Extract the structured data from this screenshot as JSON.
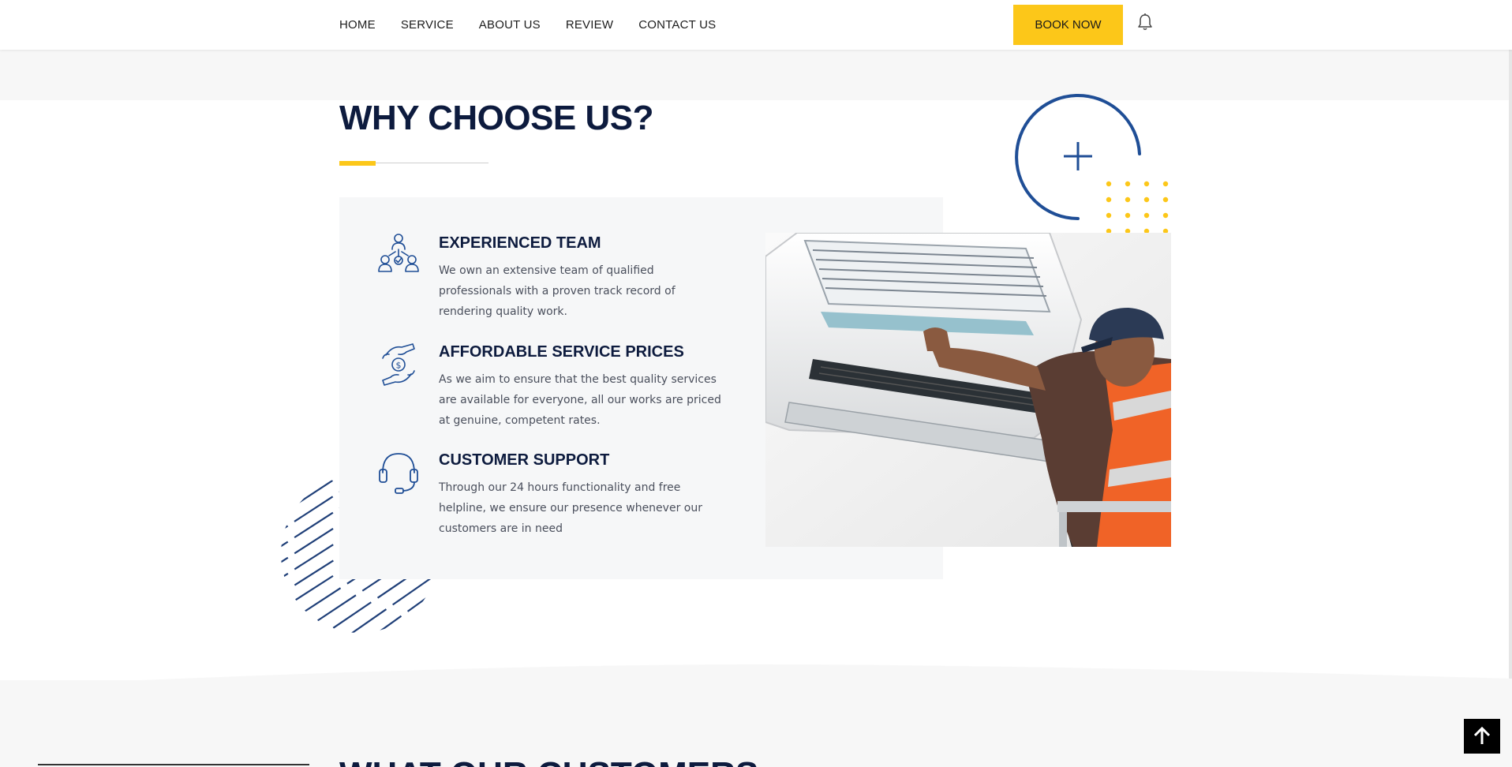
{
  "nav": {
    "items": [
      "HOME",
      "SERVICE",
      "ABOUT US",
      "REVIEW",
      "CONTACT US"
    ],
    "book_label": "BOOK NOW"
  },
  "section": {
    "title": "WHY CHOOSE US?",
    "features": [
      {
        "icon": "team-icon",
        "title": "EXPERIENCED TEAM",
        "text": "We own an extensive team of qualified professionals with a proven track record of rendering quality work."
      },
      {
        "icon": "hand-money-icon",
        "title": "AFFORDABLE SERVICE PRICES",
        "text": "As we aim to ensure that the best quality services are available for everyone, all our works are priced at genuine, competent rates."
      },
      {
        "icon": "headset-icon",
        "title": "CUSTOMER SUPPORT",
        "text": "Through our 24 hours functionality and free helpline, we ensure our presence whenever our customers are in need"
      }
    ]
  },
  "next_section": {
    "title": "WHAT OUR CUSTOMERS SAY"
  },
  "colors": {
    "accent": "#fcc719",
    "navy": "#0d1b3e",
    "icon_blue": "#1f4e96"
  }
}
